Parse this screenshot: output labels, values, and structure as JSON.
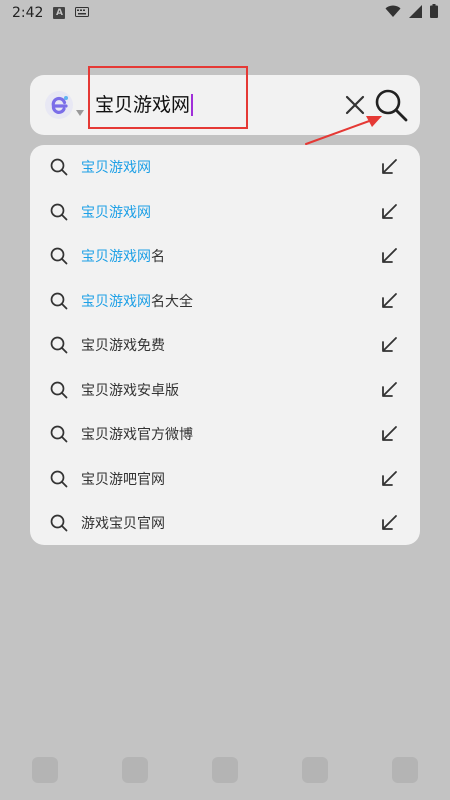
{
  "status_bar": {
    "time": "2:42",
    "notification_icon": "A"
  },
  "search": {
    "query": "宝贝游戏网",
    "engine_icon": "edge-e-logo"
  },
  "suggestions": [
    {
      "highlight": "宝贝游戏网",
      "rest": ""
    },
    {
      "highlight": "宝贝游戏网",
      "rest": ""
    },
    {
      "highlight": "宝贝游戏网",
      "rest": "名"
    },
    {
      "highlight": "宝贝游戏网",
      "rest": "名大全"
    },
    {
      "highlight": "",
      "rest": "宝贝游戏免费"
    },
    {
      "highlight": "",
      "rest": "宝贝游戏安卓版"
    },
    {
      "highlight": "",
      "rest": "宝贝游戏官方微博"
    },
    {
      "highlight": "",
      "rest": "宝贝游吧官网"
    },
    {
      "highlight": "",
      "rest": "游戏宝贝官网"
    }
  ],
  "colors": {
    "highlight": "#1ea0e6",
    "annotation": "#e53935",
    "caret": "#a02fd9"
  }
}
